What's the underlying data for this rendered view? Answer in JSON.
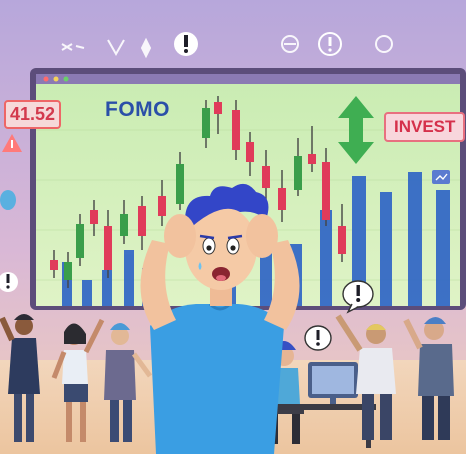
{
  "scene": {
    "ticker_value": "41.52",
    "headline": "FOMO",
    "invest_sign": "INVEST"
  },
  "colors": {
    "sky": "#b3a4d8",
    "chart_bg": "#c8ebb0",
    "bull_candle": "#3a9e4a",
    "bear_candle": "#e03b5a",
    "volume_bar": "#2b63c6",
    "shirt": "#3a9ee3",
    "hair": "#3346c8",
    "ground": "#f0d2b0"
  },
  "icons": [
    "exclamation-icon",
    "arrow-up-down-icon",
    "sparkle-icon",
    "chart-icon"
  ]
}
